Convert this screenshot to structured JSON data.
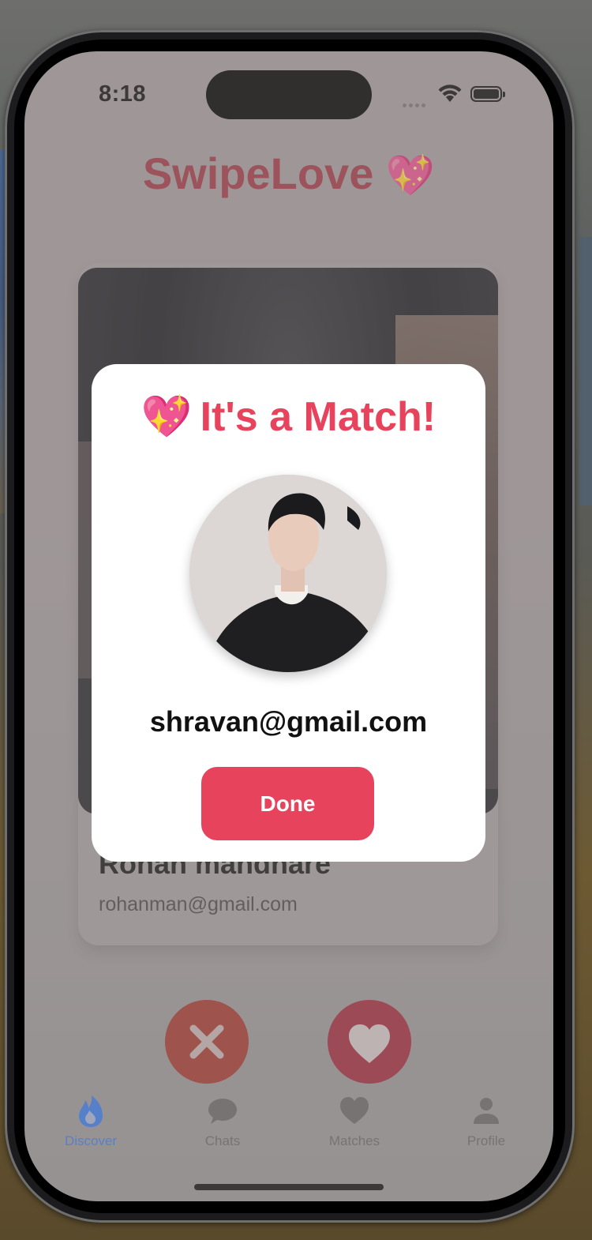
{
  "status": {
    "time": "8:18"
  },
  "app": {
    "title": "SwipeLove",
    "title_emoji": "💖"
  },
  "card": {
    "name": "Rohan mandhare",
    "email": "rohanman@gmail.com"
  },
  "match_modal": {
    "emoji": "💖",
    "title": "It's a Match!",
    "email": "shravan@gmail.com",
    "done_label": "Done"
  },
  "tabs": [
    {
      "label": "Discover",
      "icon": "flame-icon",
      "active": true
    },
    {
      "label": "Chats",
      "icon": "chat-bubble-icon",
      "active": false
    },
    {
      "label": "Matches",
      "icon": "heart-icon",
      "active": false
    },
    {
      "label": "Profile",
      "icon": "person-icon",
      "active": false
    }
  ],
  "colors": {
    "accent": "#e8435d",
    "tab_active": "#3a7ff0",
    "tab_inactive": "#6e6b6b",
    "reject_button": "#a83930",
    "like_button": "#a52c3c"
  }
}
